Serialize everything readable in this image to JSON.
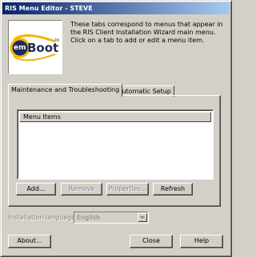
{
  "window": {
    "title": "RIS Menu Editor - STEVE"
  },
  "logo": {
    "em": "em",
    "boot": "Boot",
    "tm": "TM"
  },
  "description": "These tabs correspond to menus that appear in the RIS Client Installation Wizard main menu. Click on a tab to add or edit a menu item.",
  "tabs": [
    {
      "label": "Maintenance and Troubleshooting",
      "active": true
    },
    {
      "label": "Automatic Setup",
      "active": false
    }
  ],
  "list": {
    "column_header": "Menu Items"
  },
  "buttons": {
    "add": "Add...",
    "remove": "Remove",
    "properties": "Properties...",
    "refresh": "Refresh",
    "about": "About...",
    "close": "Close",
    "help": "Help"
  },
  "language": {
    "label": "Installation language:",
    "value": "English"
  },
  "colors": {
    "title_start": "#0a246a",
    "title_end": "#a6caf0",
    "logo_ring": "#f2b705",
    "logo_dark": "#1f2a5a",
    "face": "#d4d0c8"
  }
}
